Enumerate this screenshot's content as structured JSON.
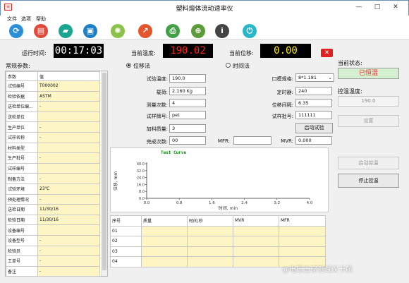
{
  "window": {
    "title": "塑料熔体流动速率仪",
    "app_icon": "≡",
    "min_glyph": "—",
    "max_glyph": "□",
    "close_glyph": "✕"
  },
  "menu": [
    "文件",
    "选项",
    "帮助"
  ],
  "toolbar": {
    "icons": [
      {
        "name": "refresh-icon",
        "glyph": "⟳",
        "color": "#2a8fd8"
      },
      {
        "name": "document-icon",
        "glyph": "▤",
        "color": "#e04a3c"
      },
      {
        "name": "open-folder-icon",
        "glyph": "▰",
        "color": "#19a58f"
      },
      {
        "name": "save-icon",
        "glyph": "▣",
        "color": "#1f7fc4"
      },
      {
        "name": "settings-icon",
        "glyph": "✺",
        "color": "#8bc34a"
      },
      {
        "name": "export-icon",
        "glyph": "↗",
        "color": "#e4572e"
      },
      {
        "name": "printer-icon",
        "glyph": "⎙",
        "color": "#43a047"
      },
      {
        "name": "zoom-icon",
        "glyph": "⊕",
        "color": "#5d9c3a"
      },
      {
        "name": "info-icon",
        "glyph": "i",
        "color": "#444444"
      },
      {
        "name": "power-icon",
        "glyph": "⏻",
        "color": "#29b6c9"
      }
    ]
  },
  "status": {
    "run_time_label": "运行时间:",
    "run_time": "00:17:03",
    "current_temp_label": "当前温度:",
    "current_temp": "190.02",
    "current_disp_label": "当前位移:",
    "current_disp": "0.00",
    "alarm_glyph": "✕"
  },
  "colors": {
    "run_time": "#ffffff",
    "current_temp": "#ff2020",
    "current_disp": "#ffee00",
    "alarm": "#e02020",
    "state": "#e03030",
    "table_fill": "#fdf6c4"
  },
  "params": {
    "title": "常规参数:",
    "headers": [
      "参数",
      "值"
    ],
    "rows": [
      {
        "k": "试验编号",
        "v": "T000002"
      },
      {
        "k": "检验依据",
        "v": "ASTM"
      },
      {
        "k": "送检单位编...",
        "v": "-"
      },
      {
        "k": "送检单位",
        "v": ""
      },
      {
        "k": "生产单位",
        "v": "-"
      },
      {
        "k": "试样名称",
        "v": "-"
      },
      {
        "k": "材料类型",
        "v": ""
      },
      {
        "k": "生产批号",
        "v": "-"
      },
      {
        "k": "试样编号",
        "v": ""
      },
      {
        "k": "制备方法",
        "v": "-"
      },
      {
        "k": "试验环境",
        "v": "23℃"
      },
      {
        "k": "预处理情况",
        "v": "-"
      },
      {
        "k": "送检日期",
        "v": "11/30/16"
      },
      {
        "k": "检验日期",
        "v": "11/30/16"
      },
      {
        "k": "设备编号",
        "v": ""
      },
      {
        "k": "设备型号",
        "v": "-"
      },
      {
        "k": "检验员",
        "v": "-"
      },
      {
        "k": "工单号",
        "v": "-"
      },
      {
        "k": "备注",
        "v": "-"
      }
    ]
  },
  "method": {
    "displacement": "位移法",
    "time": "时间法",
    "selected": "displacement"
  },
  "form": {
    "test_temp_label": "试验温度:",
    "test_temp": "190.0",
    "load_label": "载荷:",
    "load": "2.160 Kg",
    "measure_count_label": "测量次数:",
    "measure_count": "4",
    "grade_label": "试样牌号:",
    "grade": "pet",
    "charge_mass_label": "加料质量:",
    "charge_mass": "3",
    "done_count_label": "完成次数:",
    "done_count": "00",
    "mfr_label": "MFR:",
    "mfr": "",
    "mvr_label": "MVR:",
    "mvr": "0.000",
    "die_label": "口模规格:",
    "die": "8*1.181",
    "timer_label": "定时器:",
    "timer": "240",
    "interval_label": "位移间隔:",
    "interval": "6.35",
    "batch_label": "试样批号:",
    "batch": "111111",
    "start_test": "启动试验"
  },
  "chart_data": {
    "type": "line",
    "title": "Test Curve",
    "xlabel": "时间, min",
    "ylabel": "位移, mm",
    "xlim": [
      0,
      4.0
    ],
    "ylim": [
      0,
      40.0
    ],
    "x_ticks": [
      "0.0",
      "0.8",
      "1.6",
      "2.4",
      "3.2",
      "4.0"
    ],
    "y_ticks": [
      "0.0",
      "8.0",
      "16.0",
      "24.0",
      "32.0",
      "40.0"
    ],
    "series": []
  },
  "results": {
    "headers": [
      "序号",
      "质量",
      "时间,秒",
      "MVR",
      "MFR"
    ],
    "rows": [
      [
        "01",
        "",
        "",
        "",
        ""
      ],
      [
        "02",
        "",
        "",
        "",
        ""
      ],
      [
        "03",
        "",
        "",
        "",
        ""
      ],
      [
        "04",
        "",
        "",
        "",
        ""
      ]
    ]
  },
  "right": {
    "state_label": "当前状态:",
    "state": "已恒温",
    "ctrl_temp_label": "控温温度:",
    "ctrl_temp": "190.0",
    "set": "设置",
    "start_ctrl": "启动控温",
    "stop_ctrl": "停止控温"
  },
  "watermark": "@电压击穿测试仪卡航"
}
